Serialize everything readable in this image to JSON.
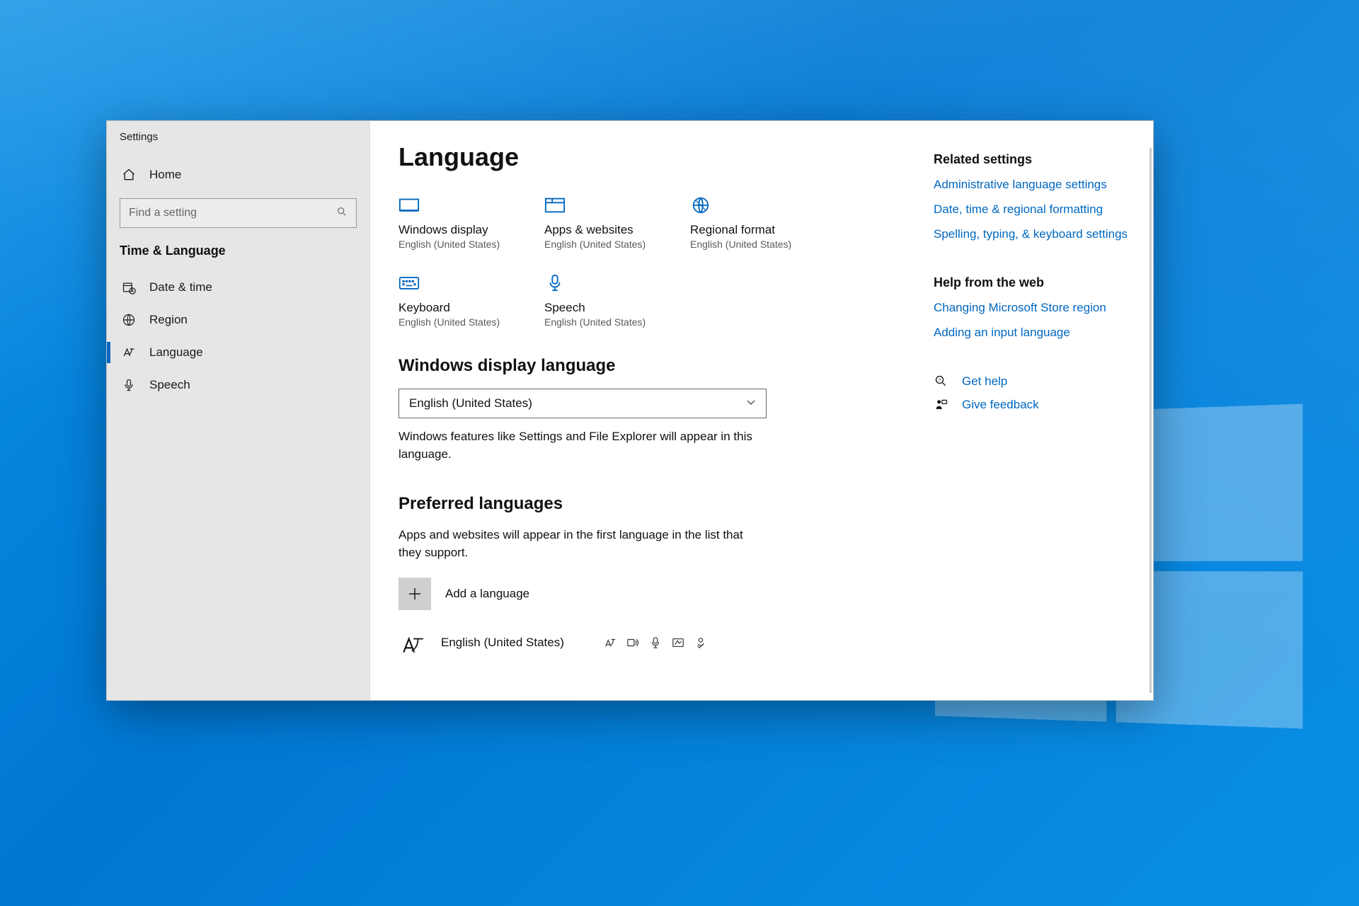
{
  "window": {
    "app_title": "Settings"
  },
  "sidebar": {
    "home_label": "Home",
    "search_placeholder": "Find a setting",
    "section": "Time & Language",
    "items": [
      {
        "label": "Date & time"
      },
      {
        "label": "Region"
      },
      {
        "label": "Language"
      },
      {
        "label": "Speech"
      }
    ]
  },
  "page": {
    "title": "Language",
    "tiles": [
      {
        "label": "Windows display",
        "sub": "English (United States)"
      },
      {
        "label": "Apps & websites",
        "sub": "English (United States)"
      },
      {
        "label": "Regional format",
        "sub": "English (United States)"
      },
      {
        "label": "Keyboard",
        "sub": "English (United States)"
      },
      {
        "label": "Speech",
        "sub": "English (United States)"
      }
    ],
    "display_lang_heading": "Windows display language",
    "display_lang_value": "English (United States)",
    "display_lang_hint": "Windows features like Settings and File Explorer will appear in this language.",
    "preferred_heading": "Preferred languages",
    "preferred_hint": "Apps and websites will appear in the first language in the list that they support.",
    "add_language_label": "Add a language",
    "installed_lang": "English (United States)"
  },
  "rail": {
    "related_heading": "Related settings",
    "related_links": [
      "Administrative language settings",
      "Date, time & regional formatting",
      "Spelling, typing, & keyboard settings"
    ],
    "help_heading": "Help from the web",
    "help_links": [
      "Changing Microsoft Store region",
      "Adding an input language"
    ],
    "get_help": "Get help",
    "give_feedback": "Give feedback"
  }
}
